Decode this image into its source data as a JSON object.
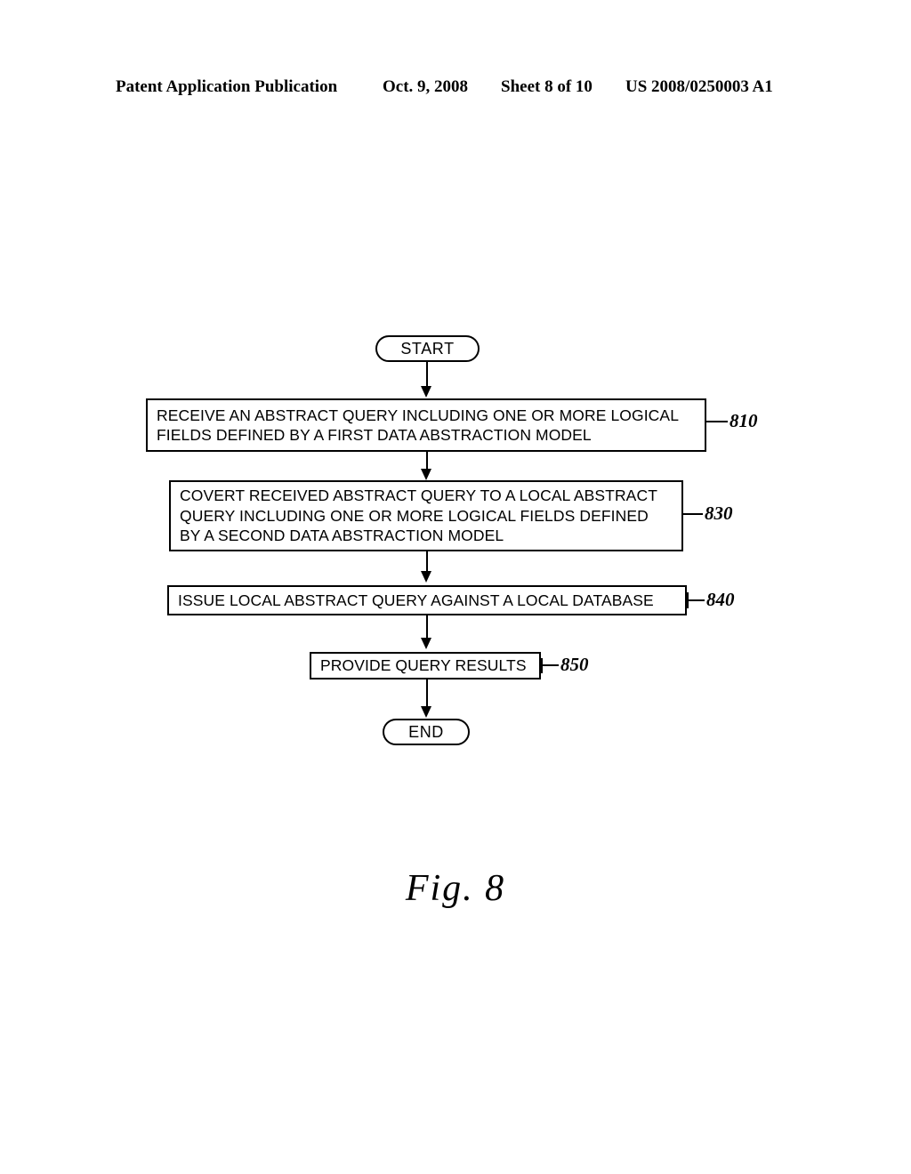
{
  "header": {
    "publication": "Patent Application Publication",
    "date": "Oct. 9, 2008",
    "sheet": "Sheet 8 of 10",
    "patent_number": "US 2008/0250003 A1"
  },
  "figure": {
    "caption": "Fig.  8"
  },
  "flowchart": {
    "nodes": [
      {
        "id": "start",
        "shape": "terminator",
        "label": "START"
      },
      {
        "id": "step-810",
        "shape": "process",
        "ref": "810",
        "label": "RECEIVE AN ABSTRACT QUERY INCLUDING ONE OR MORE LOGICAL\nFIELDS DEFINED BY A FIRST DATA ABSTRACTION MODEL"
      },
      {
        "id": "step-830",
        "shape": "process",
        "ref": "830",
        "label": "COVERT RECEIVED ABSTRACT QUERY TO A LOCAL ABSTRACT\nQUERY INCLUDING ONE OR MORE LOGICAL FIELDS DEFINED\nBY A SECOND DATA ABSTRACTION MODEL"
      },
      {
        "id": "step-840",
        "shape": "process",
        "ref": "840",
        "label": "ISSUE LOCAL ABSTRACT QUERY AGAINST A LOCAL DATABASE"
      },
      {
        "id": "step-850",
        "shape": "process",
        "ref": "850",
        "label": "PROVIDE QUERY RESULTS"
      },
      {
        "id": "end",
        "shape": "terminator",
        "label": "END"
      }
    ]
  },
  "colors": {
    "ink": "#000000",
    "paper": "#ffffff"
  }
}
